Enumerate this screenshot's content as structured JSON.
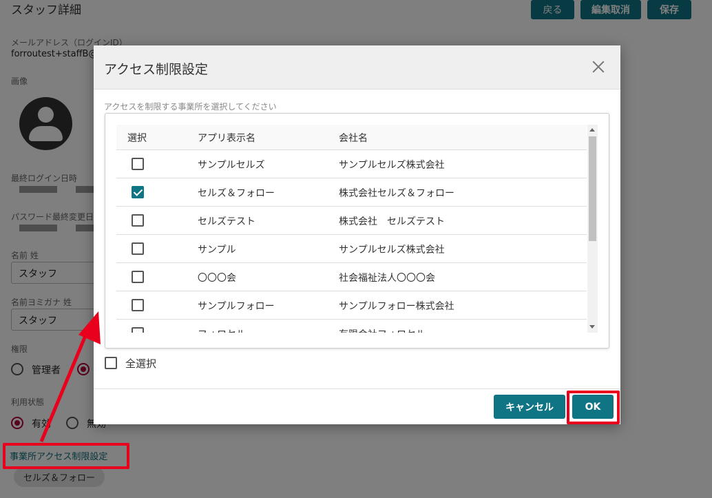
{
  "page": {
    "title": "スタッフ詳細",
    "buttons": {
      "back": "戻る",
      "cancel_edit": "編集取消",
      "save": "保存"
    },
    "email": {
      "label": "メールアドレス（ログインID）",
      "value": "forroutest+staffB@"
    },
    "image_label": "画像",
    "last_login_label": "最終ログイン日時",
    "password_changed_label": "パスワード最終変更日",
    "last_name": {
      "label": "名前 姓",
      "value": "スタッフ"
    },
    "last_name_kana": {
      "label": "名前ヨミガナ 姓",
      "value": "スタッフ"
    },
    "role": {
      "label": "権限",
      "options": [
        "管理者"
      ]
    },
    "usage_status": {
      "label": "利用状態",
      "options": [
        "有効",
        "無効"
      ],
      "selected": "有効"
    },
    "access_link": "事業所アクセス制限設定",
    "assigned_chip": "セルズ＆フォロー"
  },
  "dialog": {
    "title": "アクセス制限設定",
    "instruction": "アクセスを制限する事業所を選択してください",
    "columns": {
      "select": "選択",
      "app_name": "アプリ表示名",
      "company": "会社名"
    },
    "rows": [
      {
        "app_name": "サンプルセルズ",
        "company": "サンプルセルズ株式会社",
        "checked": false
      },
      {
        "app_name": "セルズ＆フォロー",
        "company": "株式会社セルズ＆フォロー",
        "checked": true
      },
      {
        "app_name": "セルズテスト",
        "company": "株式会社　セルズテスト",
        "checked": false
      },
      {
        "app_name": "サンプル",
        "company": "サンプルセルズ株式会社",
        "checked": false
      },
      {
        "app_name": "〇〇〇会",
        "company": "社会福祉法人〇〇〇会",
        "checked": false
      },
      {
        "app_name": "サンプルフォロー",
        "company": "サンプルフォロー株式会社",
        "checked": false
      },
      {
        "app_name": "フォロセル",
        "company": "有限会社フォロセル",
        "checked": false
      }
    ],
    "select_all": "全選択",
    "cancel": "キャンセル",
    "ok": "OK"
  },
  "colors": {
    "primary": "#0f7585",
    "radio_selected": "#b0003a",
    "annotation": "#e8001c"
  }
}
